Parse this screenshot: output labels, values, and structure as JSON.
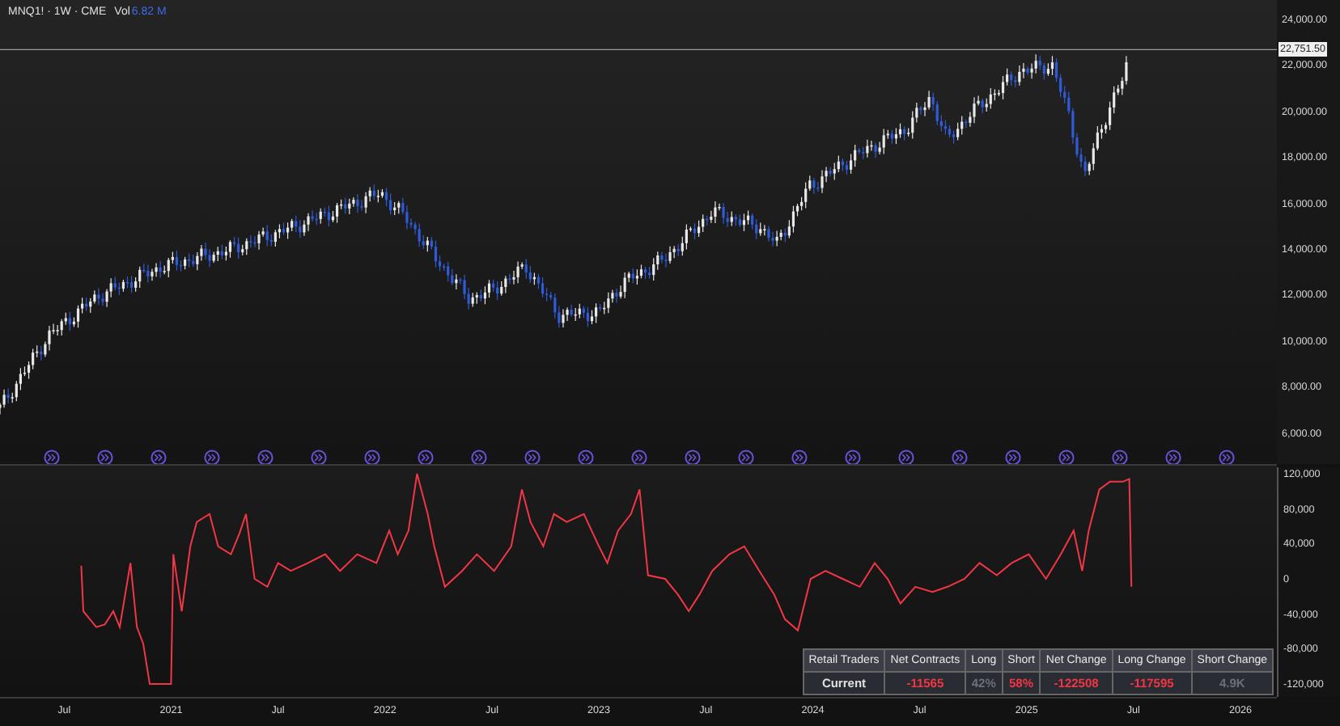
{
  "legend": {
    "symbol": "MNQ1! · 1W · CME",
    "volume_label": "Vol",
    "volume_value": "6.82 M"
  },
  "price_axis": {
    "labels": [
      "24,000.00",
      "22,000.00",
      "20,000.00",
      "18,000.00",
      "16,000.00",
      "14,000.00",
      "12,000.00",
      "10,000.00",
      "8,000.00",
      "6,000.00"
    ],
    "last_price": "22,751.50"
  },
  "sentiment_pane": {
    "chart_data": {
      "type": "line",
      "xlim": [
        2020.2,
        2026.17
      ],
      "ylim": [
        -134800,
        129200
      ],
      "yticks": [
        {
          "value": 120000,
          "label": "120,000"
        },
        {
          "value": 80000,
          "label": "80,000"
        },
        {
          "value": 40000,
          "label": "40,000"
        },
        {
          "value": 0,
          "label": "0"
        },
        {
          "value": -40000,
          "label": "-40,000"
        },
        {
          "value": -80000,
          "label": "-80,000"
        },
        {
          "value": -120000,
          "label": "-120,000"
        }
      ],
      "xticks": [
        {
          "value": 2020.5,
          "label": "Jul"
        },
        {
          "value": 2021,
          "label": "2021"
        },
        {
          "value": 2021.5,
          "label": "Jul"
        },
        {
          "value": 2022,
          "label": "2022"
        },
        {
          "value": 2022.5,
          "label": "Jul"
        },
        {
          "value": 2023,
          "label": "2023"
        },
        {
          "value": 2023.5,
          "label": "Jul"
        },
        {
          "value": 2024,
          "label": "2024"
        },
        {
          "value": 2024.5,
          "label": "Jul"
        },
        {
          "value": 2025,
          "label": "2025"
        },
        {
          "value": 2025.5,
          "label": "Jul"
        },
        {
          "value": 2026,
          "label": "2026"
        }
      ],
      "x": [
        2020.58,
        2020.59,
        2020.62,
        2020.65,
        2020.69,
        2020.73,
        2020.76,
        2020.81,
        2020.84,
        2020.87,
        2020.9,
        2020.96,
        2021.0,
        2021.01,
        2021.05,
        2021.09,
        2021.12,
        2021.18,
        2021.22,
        2021.28,
        2021.32,
        2021.35,
        2021.39,
        2021.45,
        2021.5,
        2021.56,
        2021.64,
        2021.72,
        2021.79,
        2021.87,
        2021.96,
        2022.02,
        2022.06,
        2022.11,
        2022.15,
        2022.2,
        2022.23,
        2022.28,
        2022.36,
        2022.43,
        2022.51,
        2022.59,
        2022.64,
        2022.68,
        2022.74,
        2022.79,
        2022.85,
        2022.93,
        2023.0,
        2023.04,
        2023.09,
        2023.15,
        2023.19,
        2023.23,
        2023.31,
        2023.37,
        2023.42,
        2023.47,
        2023.53,
        2023.61,
        2023.68,
        2023.75,
        2023.82,
        2023.87,
        2023.93,
        2023.99,
        2024.06,
        2024.14,
        2024.22,
        2024.29,
        2024.35,
        2024.41,
        2024.48,
        2024.56,
        2024.63,
        2024.71,
        2024.78,
        2024.86,
        2024.93,
        2025.01,
        2025.09,
        2025.16,
        2025.22,
        2025.26,
        2025.29,
        2025.34,
        2025.39,
        2025.45,
        2025.48,
        2025.49
      ],
      "series": [
        {
          "color": "#f23645",
          "values": [
            15000,
            -37000,
            -46000,
            -55000,
            -52000,
            -37000,
            -55000,
            18000,
            -55000,
            -74000,
            -120000,
            -120000,
            -120000,
            28000,
            -37000,
            37000,
            65000,
            74000,
            37000,
            28000,
            52000,
            74000,
            0,
            -9000,
            18000,
            9000,
            18000,
            28000,
            9000,
            28000,
            18000,
            55000,
            28000,
            55000,
            120000,
            74000,
            37000,
            -9000,
            9000,
            28000,
            9000,
            37000,
            102000,
            65000,
            37000,
            74000,
            65000,
            74000,
            37000,
            18000,
            55000,
            74000,
            102000,
            4000,
            0,
            -18000,
            -37000,
            -18000,
            9000,
            28000,
            37000,
            9000,
            -18000,
            -46000,
            -59000,
            0,
            9000,
            0,
            -9000,
            18000,
            0,
            -28000,
            -9000,
            -15000,
            -9000,
            0,
            18000,
            4000,
            18000,
            28000,
            0,
            28000,
            55000,
            9000,
            55000,
            102000,
            111000,
            111000,
            114000,
            -9000
          ]
        }
      ]
    }
  },
  "table": {
    "columns": [
      "Retail Traders",
      "Net Contracts",
      "Long",
      "Short",
      "Net Change",
      "Long Change",
      "Short Change"
    ],
    "rows": [
      {
        "cells": [
          {
            "text": "Current",
            "color": "#e0e0e0"
          },
          {
            "text": "-11565",
            "color": "#f23645"
          },
          {
            "text": "42%",
            "color": "#6b6f78"
          },
          {
            "text": "58%",
            "color": "#f23645"
          },
          {
            "text": "-122508",
            "color": "#f23645"
          },
          {
            "text": "-117595",
            "color": "#f23645"
          },
          {
            "text": "4.9K",
            "color": "#6b6f78"
          }
        ]
      }
    ]
  }
}
